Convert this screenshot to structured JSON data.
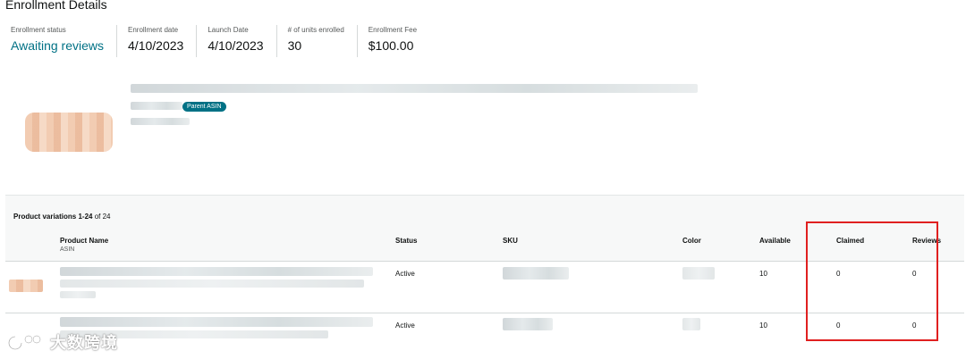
{
  "page": {
    "title": "Enrollment Details"
  },
  "summary": {
    "status_label": "Enrollment status",
    "status_value": "Awaiting reviews",
    "enroll_date_label": "Enrollment date",
    "enroll_date_value": "4/10/2023",
    "launch_date_label": "Launch Date",
    "launch_date_value": "4/10/2023",
    "units_label": "# of units enrolled",
    "units_value": "30",
    "fee_label": "Enrollment Fee",
    "fee_value": "$100.00"
  },
  "product": {
    "parent_badge": "Parent ASIN"
  },
  "table": {
    "title_bold": "Product variations 1-24",
    "title_rest": " of 24",
    "columns": {
      "product_name": "Product Name",
      "asin": "ASIN",
      "status": "Status",
      "sku": "SKU",
      "color": "Color",
      "available": "Available",
      "claimed": "Claimed",
      "reviews": "Reviews"
    },
    "rows": [
      {
        "status": "Active",
        "available": "10",
        "claimed": "0",
        "reviews": "0"
      },
      {
        "status": "Active",
        "available": "10",
        "claimed": "0",
        "reviews": "0"
      }
    ]
  },
  "watermark": {
    "text": "大数跨境"
  },
  "colors": {
    "link": "#007185",
    "badge": "#007185",
    "highlight_box": "#e02020"
  }
}
